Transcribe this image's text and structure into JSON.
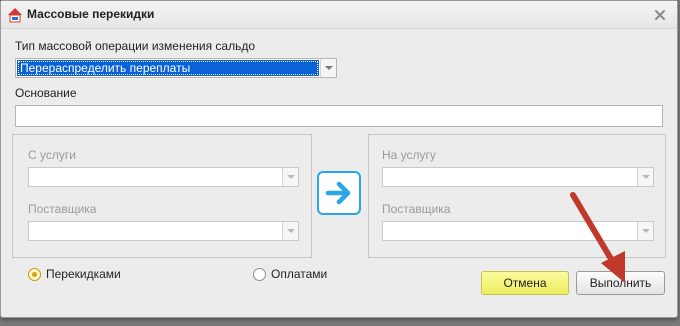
{
  "window": {
    "title": "Массовые перекидки",
    "icon": "app-logo-icon",
    "close_icon": "close-icon"
  },
  "operation": {
    "label": "Тип массовой операции изменения сальдо",
    "value": "Перераспределить переплаты"
  },
  "basis": {
    "label": "Основание",
    "value": ""
  },
  "from": {
    "service_label": "С услуги",
    "service_value": "",
    "supplier_label": "Поставщика",
    "supplier_value": ""
  },
  "to": {
    "service_label": "На услугу",
    "service_value": "",
    "supplier_label": "Поставщика",
    "supplier_value": ""
  },
  "transfer_arrow_icon": "arrow-right-icon",
  "mode": {
    "options": [
      {
        "label": "Перекидками",
        "checked": true
      },
      {
        "label": "Оплатами",
        "checked": false
      }
    ]
  },
  "buttons": {
    "cancel": "Отмена",
    "run": "Выполнить"
  },
  "colors": {
    "accent": "#2aa6e8",
    "selection": "#0a62d6",
    "cancel_bg": "#eded60",
    "annotation_arrow": "#c0392b"
  }
}
